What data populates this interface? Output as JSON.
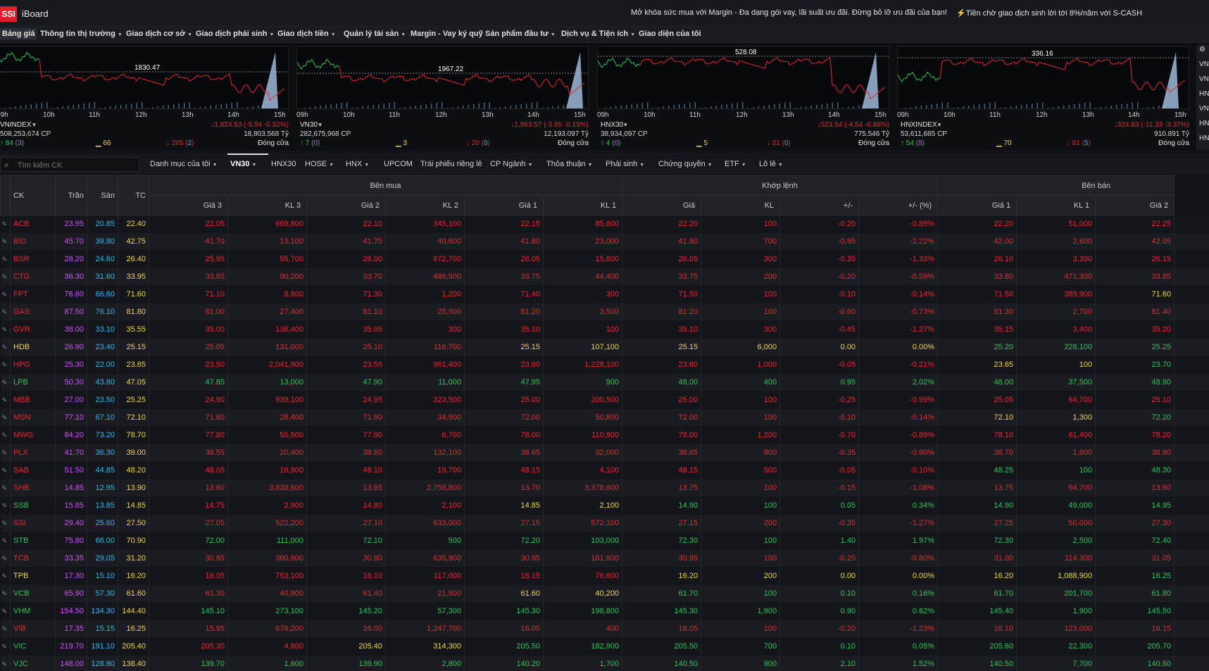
{
  "topbar": {
    "logo": "SSI",
    "app_name": "iBoard",
    "promo_margin": "Mở khóa sức mua với Margin - Đa dạng gói vay, lãi suất ưu đãi. Đừng bỏ lỡ ưu đãi của bạn!",
    "promo_scash": "Tiền chờ giao dịch sinh lời tới 8%/năm với S-CASH"
  },
  "menu": [
    {
      "label": "Bảng giá",
      "active": true
    },
    {
      "label": "Thông tin thị trường"
    },
    {
      "label": "Giao dịch cơ sở"
    },
    {
      "label": "Giao dịch phái sinh"
    },
    {
      "label": "Giao dịch tiền"
    },
    {
      "label": "Quản lý tài sản"
    },
    {
      "label": "Margin - Vay ký quỹ"
    },
    {
      "label": "Sản phẩm đầu tư"
    },
    {
      "label": "Dịch vụ & Tiện ích"
    },
    {
      "label": "Giao diện của tôi"
    }
  ],
  "index_panels": [
    {
      "name": "VNINDEX",
      "ref_value": "1830.47",
      "change": "1,824.53 (-5.94 -0.32%)",
      "volume": "508,253,674 CP",
      "value": "18,803.568 Tỷ",
      "up": "84",
      "up_ceil": "3",
      "unchanged": "66",
      "down": "205",
      "down_floor": "2",
      "status": "Đóng cửa"
    },
    {
      "name": "VN30",
      "ref_value": "1967.22",
      "change": "1,963.57 (-3.65 -0.19%)",
      "volume": "282,675,968 CP",
      "value": "12,193.097 Tỷ",
      "up": "7",
      "up_ceil": "0",
      "unchanged": "3",
      "down": "20",
      "down_floor": "0",
      "status": "Đóng cửa"
    },
    {
      "name": "HNX30",
      "ref_value": "528.08",
      "change": "523.54 (-4.54 -0.86%)",
      "volume": "38,934,097 CP",
      "value": "775.546 Tỷ",
      "up": "4",
      "up_ceil": "0",
      "unchanged": "5",
      "down": "21",
      "down_floor": "0",
      "status": "Đóng cửa"
    },
    {
      "name": "HNXINDEX",
      "ref_value": "336.16",
      "change": "324.83 (-11.33 -3.37%)",
      "volume": "53,611,685 CP",
      "value": "910.891 Tỷ",
      "up": "54",
      "up_ceil": "8",
      "unchanged": "70",
      "down": "81",
      "down_floor": "5",
      "status": "Đóng cửa"
    }
  ],
  "time_ticks": [
    "09h",
    "10h",
    "11h",
    "12h",
    "13h",
    "14h",
    "15h"
  ],
  "side_tabs": [
    "⚙",
    "VN",
    "VN",
    "HN",
    "VN",
    "HN",
    "HN"
  ],
  "search": {
    "placeholder": "Tìm kiếm CK"
  },
  "tabs": [
    {
      "label": "Danh mục của tôi",
      "caret": true
    },
    {
      "label": "VN30",
      "caret": true,
      "active": true
    },
    {
      "label": "HNX30"
    },
    {
      "label": "HOSE",
      "caret": true
    },
    {
      "label": "HNX",
      "caret": true
    },
    {
      "label": "UPCOM"
    },
    {
      "label": "Trái phiếu riêng lẻ"
    },
    {
      "label": "CP Ngành",
      "caret": true
    },
    {
      "label": "Thỏa thuận",
      "caret": true
    },
    {
      "label": "Phái sinh",
      "caret": true
    },
    {
      "label": "Chứng quyền",
      "caret": true
    },
    {
      "label": "ETF",
      "caret": true
    },
    {
      "label": "Lô lẻ",
      "caret": true
    }
  ],
  "table": {
    "headers": {
      "ck": "CK",
      "ceil": "Trần",
      "floor": "Sàn",
      "ref": "TC",
      "buy_group": "Bên mua",
      "match_group": "Khớp lệnh",
      "sell_group": "Bên bán"
    },
    "sub_headers": [
      "Giá 3",
      "KL 3",
      "Giá 2",
      "KL 2",
      "Giá 1",
      "KL 1",
      "Giá",
      "KL",
      "+/-",
      "+/- (%)",
      "Giá 1",
      "KL 1",
      "Giá 2"
    ],
    "rows": [
      {
        "ck": "ACB",
        "ceil": "23.95",
        "floor": "20.85",
        "ref": "22.40",
        "c": "r",
        "cells": [
          "22.05",
          "669,800",
          "22.10",
          "345,100",
          "22.15",
          "85,600",
          "22.20",
          "100",
          "-0.20",
          "-0.89%",
          "22.20",
          "51,000",
          "22.25"
        ],
        "cols": "rrrrrrrrrrrrr"
      },
      {
        "ck": "BID",
        "ceil": "45.70",
        "floor": "39.80",
        "ref": "42.75",
        "c": "r",
        "cells": [
          "41.70",
          "13,100",
          "41.75",
          "40,600",
          "41.80",
          "23,000",
          "41.80",
          "700",
          "-0.95",
          "-2.22%",
          "42.00",
          "2,600",
          "42.05"
        ],
        "cols": "rrrrrrrrrrrrr"
      },
      {
        "ck": "BSR",
        "ceil": "28.20",
        "floor": "24.60",
        "ref": "26.40",
        "c": "r",
        "cells": [
          "25.95",
          "55,700",
          "26.00",
          "872,700",
          "26.05",
          "15,800",
          "26.05",
          "300",
          "-0.35",
          "-1.33%",
          "26.10",
          "3,300",
          "26.15"
        ],
        "cols": "rrrrrrrrrrrrr"
      },
      {
        "ck": "CTG",
        "ceil": "36.30",
        "floor": "31.60",
        "ref": "33.95",
        "c": "r",
        "cells": [
          "33.65",
          "90,200",
          "33.70",
          "486,500",
          "33.75",
          "44,400",
          "33.75",
          "200",
          "-0.20",
          "-0.59%",
          "33.80",
          "471,300",
          "33.85"
        ],
        "cols": "rrrrrrrrrrrrr"
      },
      {
        "ck": "FPT",
        "ceil": "76.60",
        "floor": "66.60",
        "ref": "71.60",
        "c": "r",
        "cells": [
          "71.10",
          "8,800",
          "71.30",
          "1,200",
          "71.40",
          "300",
          "71.50",
          "100",
          "-0.10",
          "-0.14%",
          "71.50",
          "389,900",
          "71.60"
        ],
        "cols": "rrrrrrrrrrrry"
      },
      {
        "ck": "GAS",
        "ceil": "87.50",
        "floor": "76.10",
        "ref": "81.80",
        "c": "r",
        "cells": [
          "81.00",
          "27,400",
          "81.10",
          "25,500",
          "81.20",
          "3,500",
          "81.20",
          "100",
          "-0.60",
          "-0.73%",
          "81.30",
          "2,700",
          "81.40"
        ],
        "cols": "rrrrrrrrrrrrr"
      },
      {
        "ck": "GVR",
        "ceil": "38.00",
        "floor": "33.10",
        "ref": "35.55",
        "c": "r",
        "cells": [
          "35.00",
          "138,400",
          "35.05",
          "300",
          "35.10",
          "100",
          "35.10",
          "300",
          "-0.45",
          "-1.27%",
          "35.15",
          "3,400",
          "35.20"
        ],
        "cols": "rrrrrrrrrrrrr"
      },
      {
        "ck": "HDB",
        "ceil": "26.90",
        "floor": "23.40",
        "ref": "25.15",
        "c": "y",
        "cells": [
          "25.05",
          "131,000",
          "25.10",
          "116,700",
          "25.15",
          "107,100",
          "25.15",
          "6,000",
          "0.00",
          "0.00%",
          "25.20",
          "228,100",
          "25.25"
        ],
        "cols": "rrrryyyyyyggg"
      },
      {
        "ck": "HPG",
        "ceil": "25.30",
        "floor": "22.00",
        "ref": "23.65",
        "c": "r",
        "cells": [
          "23.50",
          "2,041,900",
          "23.55",
          "961,400",
          "23.60",
          "1,228,100",
          "23.60",
          "1,000",
          "-0.05",
          "-0.21%",
          "23.65",
          "100",
          "23.70"
        ],
        "cols": "rrrrrrrrrryyg"
      },
      {
        "ck": "LPB",
        "ceil": "50.30",
        "floor": "43.80",
        "ref": "47.05",
        "c": "g",
        "cells": [
          "47.85",
          "13,000",
          "47.90",
          "11,000",
          "47.95",
          "900",
          "48.00",
          "400",
          "0.95",
          "2.02%",
          "48.00",
          "37,500",
          "48.90"
        ],
        "cols": "ggggggggggggg"
      },
      {
        "ck": "MBB",
        "ceil": "27.00",
        "floor": "23.50",
        "ref": "25.25",
        "c": "r",
        "cells": [
          "24.90",
          "939,100",
          "24.95",
          "323,500",
          "25.00",
          "200,500",
          "25.00",
          "100",
          "-0.25",
          "-0.99%",
          "25.05",
          "64,700",
          "25.10"
        ],
        "cols": "rrrrrrrrrrrrr"
      },
      {
        "ck": "MSN",
        "ceil": "77.10",
        "floor": "67.10",
        "ref": "72.10",
        "c": "r",
        "cells": [
          "71.80",
          "28,400",
          "71.90",
          "34,900",
          "72.00",
          "50,800",
          "72.00",
          "100",
          "-0.10",
          "-0.14%",
          "72.10",
          "1,300",
          "72.20"
        ],
        "cols": "rrrrrrrrrryyg"
      },
      {
        "ck": "MWG",
        "ceil": "84.20",
        "floor": "73.20",
        "ref": "78.70",
        "c": "r",
        "cells": [
          "77.80",
          "55,500",
          "77.90",
          "6,700",
          "78.00",
          "110,900",
          "78.00",
          "1,200",
          "-0.70",
          "-0.89%",
          "78.10",
          "61,400",
          "78.20"
        ],
        "cols": "rrrrrrrrrrrrr"
      },
      {
        "ck": "PLX",
        "ceil": "41.70",
        "floor": "36.30",
        "ref": "39.00",
        "c": "r",
        "cells": [
          "38.55",
          "20,400",
          "38.60",
          "132,100",
          "38.65",
          "32,000",
          "38.65",
          "800",
          "-0.35",
          "-0.90%",
          "38.70",
          "1,600",
          "38.80"
        ],
        "cols": "rrrrrrrrrrrrr"
      },
      {
        "ck": "SAB",
        "ceil": "51.50",
        "floor": "44.85",
        "ref": "48.20",
        "c": "r",
        "cells": [
          "48.05",
          "16,900",
          "48.10",
          "19,700",
          "48.15",
          "4,100",
          "48.15",
          "500",
          "-0.05",
          "-0.10%",
          "48.25",
          "100",
          "48.30"
        ],
        "cols": "rrrrrrrrrrggg"
      },
      {
        "ck": "SHB",
        "ceil": "14.85",
        "floor": "12.95",
        "ref": "13.90",
        "c": "r",
        "cells": [
          "13.60",
          "3,838,800",
          "13.65",
          "2,758,800",
          "13.70",
          "3,378,600",
          "13.75",
          "100",
          "-0.15",
          "-1.08%",
          "13.75",
          "94,700",
          "13.80"
        ],
        "cols": "rrrrrrrrrrrrr"
      },
      {
        "ck": "SSB",
        "ceil": "15.85",
        "floor": "13.85",
        "ref": "14.85",
        "c": "g",
        "cells": [
          "14.75",
          "2,900",
          "14.80",
          "2,100",
          "14.85",
          "2,100",
          "14.90",
          "100",
          "0.05",
          "0.34%",
          "14.90",
          "49,000",
          "14.95"
        ],
        "cols": "rrrryyggggggg"
      },
      {
        "ck": "SSI",
        "ceil": "29.40",
        "floor": "25.60",
        "ref": "27.50",
        "c": "r",
        "cells": [
          "27.05",
          "522,200",
          "27.10",
          "633,000",
          "27.15",
          "572,100",
          "27.15",
          "200",
          "-0.35",
          "-1.27%",
          "27.25",
          "50,000",
          "27.30"
        ],
        "cols": "rrrrrrrrrrrrr"
      },
      {
        "ck": "STB",
        "ceil": "75.80",
        "floor": "66.00",
        "ref": "70.90",
        "c": "g",
        "cells": [
          "72.00",
          "111,000",
          "72.10",
          "500",
          "72.20",
          "103,000",
          "72.30",
          "100",
          "1.40",
          "1.97%",
          "72.30",
          "2,500",
          "72.40"
        ],
        "cols": "ggggggggggggg"
      },
      {
        "ck": "TCB",
        "ceil": "33.35",
        "floor": "29.05",
        "ref": "31.20",
        "c": "r",
        "cells": [
          "30.85",
          "360,900",
          "30.90",
          "635,900",
          "30.95",
          "181,600",
          "30.95",
          "100",
          "-0.25",
          "-0.80%",
          "31.00",
          "114,300",
          "31.05"
        ],
        "cols": "rrrrrrrrrrrrr"
      },
      {
        "ck": "TPB",
        "ceil": "17.30",
        "floor": "15.10",
        "ref": "16.20",
        "c": "y",
        "cells": [
          "16.05",
          "753,100",
          "16.10",
          "117,000",
          "16.15",
          "76,600",
          "16.20",
          "200",
          "0.00",
          "0.00%",
          "16.20",
          "1,088,900",
          "16.25"
        ],
        "cols": "rrrrrryyyyyyg"
      },
      {
        "ck": "VCB",
        "ceil": "65.90",
        "floor": "57.30",
        "ref": "61.60",
        "c": "g",
        "cells": [
          "61.30",
          "40,800",
          "61.40",
          "21,900",
          "61.60",
          "40,200",
          "61.70",
          "100",
          "0.10",
          "0.16%",
          "61.70",
          "201,700",
          "61.80"
        ],
        "cols": "rrrryyggggggg"
      },
      {
        "ck": "VHM",
        "ceil": "154.50",
        "floor": "134.30",
        "ref": "144.40",
        "c": "g",
        "cells": [
          "145.10",
          "273,100",
          "145.20",
          "57,300",
          "145.30",
          "198,800",
          "145.30",
          "1,900",
          "0.90",
          "0.62%",
          "145.40",
          "1,900",
          "145.50"
        ],
        "cols": "ggggggggggggg"
      },
      {
        "ck": "VIB",
        "ceil": "17.35",
        "floor": "15.15",
        "ref": "16.25",
        "c": "r",
        "cells": [
          "15.95",
          "676,200",
          "16.00",
          "1,247,700",
          "16.05",
          "400",
          "16.05",
          "100",
          "-0.20",
          "-1.23%",
          "16.10",
          "123,000",
          "16.15"
        ],
        "cols": "rrrrrrrrrrrrr"
      },
      {
        "ck": "VIC",
        "ceil": "219.70",
        "floor": "191.10",
        "ref": "205.40",
        "c": "g",
        "cells": [
          "205.30",
          "4,800",
          "205.40",
          "314,300",
          "205.50",
          "182,900",
          "205.50",
          "700",
          "0.10",
          "0.05%",
          "205.60",
          "22,300",
          "205.70"
        ],
        "cols": "rryyggggggggg"
      },
      {
        "ck": "VJC",
        "ceil": "148.00",
        "floor": "128.80",
        "ref": "138.40",
        "c": "g",
        "cells": [
          "139.70",
          "1,600",
          "139.90",
          "2,800",
          "140.20",
          "1,700",
          "140.50",
          "900",
          "2.10",
          "1.52%",
          "140.50",
          "7,700",
          "140.60"
        ],
        "cols": "ggggggggggggg"
      }
    ]
  },
  "colors": {
    "up": "#29c55a",
    "down": "#e8252f",
    "ref": "#f2d544",
    "ceil": "#d44eff",
    "floor": "#27b9f0"
  }
}
